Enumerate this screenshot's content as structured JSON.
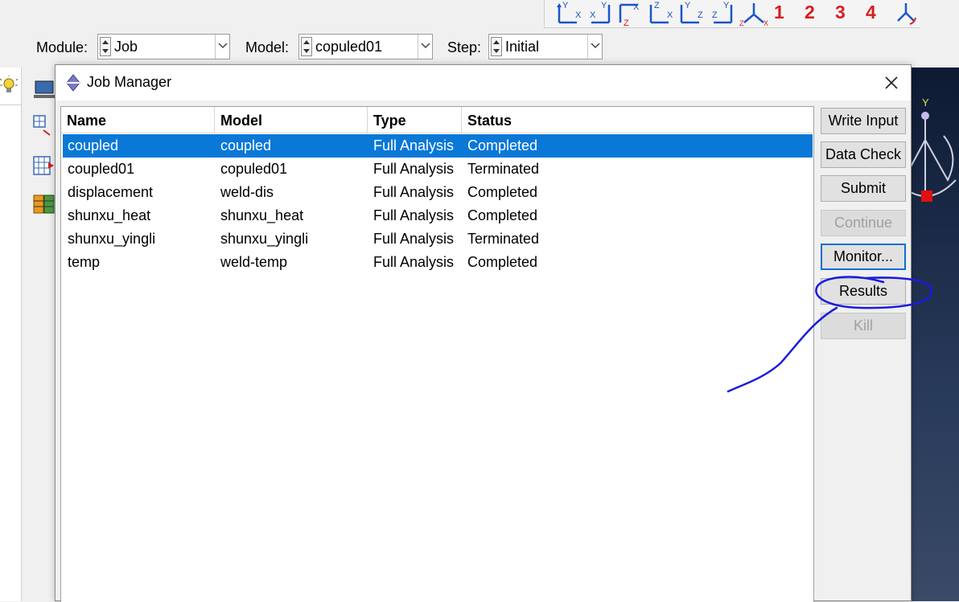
{
  "view_toolbar": {
    "icons": [
      "view-yx-icon",
      "view-xy-icon",
      "view-zx-icon",
      "view-xz-icon",
      "view-yz-icon",
      "view-zy-icon",
      "view-iso-icon",
      "view-reset-icon"
    ],
    "numbers": [
      "1",
      "2",
      "3",
      "4"
    ]
  },
  "context": {
    "module_label": "Module:",
    "module_value": "Job",
    "model_label": "Model:",
    "model_value": "copuled01",
    "step_label": "Step:",
    "step_value": "Initial"
  },
  "dialog": {
    "title": "Job Manager",
    "columns": [
      "Name",
      "Model",
      "Type",
      "Status"
    ],
    "rows": [
      {
        "name": "coupled",
        "model": "coupled",
        "type": "Full Analysis",
        "status": "Completed",
        "selected": true
      },
      {
        "name": "coupled01",
        "model": "copuled01",
        "type": "Full Analysis",
        "status": "Terminated"
      },
      {
        "name": "displacement",
        "model": "weld-dis",
        "type": "Full Analysis",
        "status": "Completed"
      },
      {
        "name": "shunxu_heat",
        "model": "shunxu_heat",
        "type": "Full Analysis",
        "status": "Completed"
      },
      {
        "name": "shunxu_yingli",
        "model": "shunxu_yingli",
        "type": "Full Analysis",
        "status": "Terminated"
      },
      {
        "name": "temp",
        "model": "weld-temp",
        "type": "Full Analysis",
        "status": "Completed"
      }
    ],
    "buttons": {
      "write_input": "Write Input",
      "data_check": "Data Check",
      "submit": "Submit",
      "continue": "Continue",
      "monitor": "Monitor...",
      "results": "Results",
      "kill": "Kill"
    }
  },
  "viewport": {
    "axis_label": "Y"
  },
  "colors": {
    "selection": "#0a78d7",
    "annotation_ink": "#1a1ae0",
    "view_numbers": "#d42020",
    "triad_marker": "#e01010"
  }
}
